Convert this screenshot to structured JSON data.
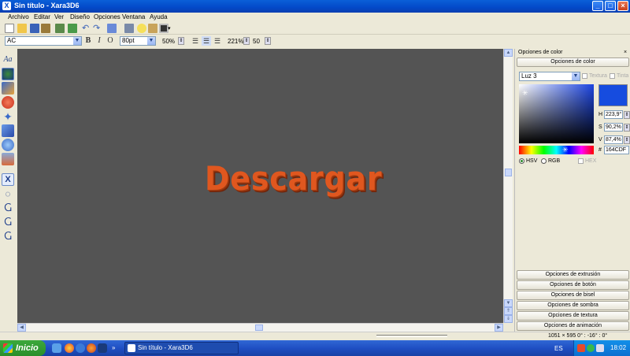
{
  "window": {
    "title": "Sin título - Xara3D6"
  },
  "menu": [
    "Archivo",
    "Editar",
    "Ver",
    "Diseño",
    "Opciones",
    "Ventana",
    "Ayuda"
  ],
  "format_bar": {
    "font": "AC",
    "size": "80pt",
    "zoom": "50%",
    "spacing": "221%",
    "value": "50",
    "bold": "B",
    "italic": "I",
    "outline": "O"
  },
  "canvas": {
    "text": "Descargar",
    "text_color": "#e0571f"
  },
  "panel": {
    "title": "Opciones de color",
    "header_button": "Opciones de color",
    "light_select": "Luz 3",
    "textura_label": "Textura",
    "tinta_label": "Tinta",
    "h_label": "H",
    "h_value": "223,9°",
    "s_label": "S",
    "s_value": "90,2%",
    "v_label": "V",
    "v_value": "87,4%",
    "hex_prefix": "#",
    "hex_value": "164CDF",
    "hsv_label": "HSV",
    "rgb_label": "RGB",
    "hex_label": "HEX",
    "swatch_color": "#164cdf",
    "sections": [
      "Opciones de extrusión",
      "Opciones de botón",
      "Opciones de bisel",
      "Opciones de sombra",
      "Opciones de textura",
      "Opciones de animación"
    ]
  },
  "status": {
    "text": "1051 × 595  0° : -16° : 0°"
  },
  "taskbar": {
    "start": "Inicio",
    "task": "Sin título - Xara3D6",
    "lang": "ES",
    "time": "18:02"
  }
}
